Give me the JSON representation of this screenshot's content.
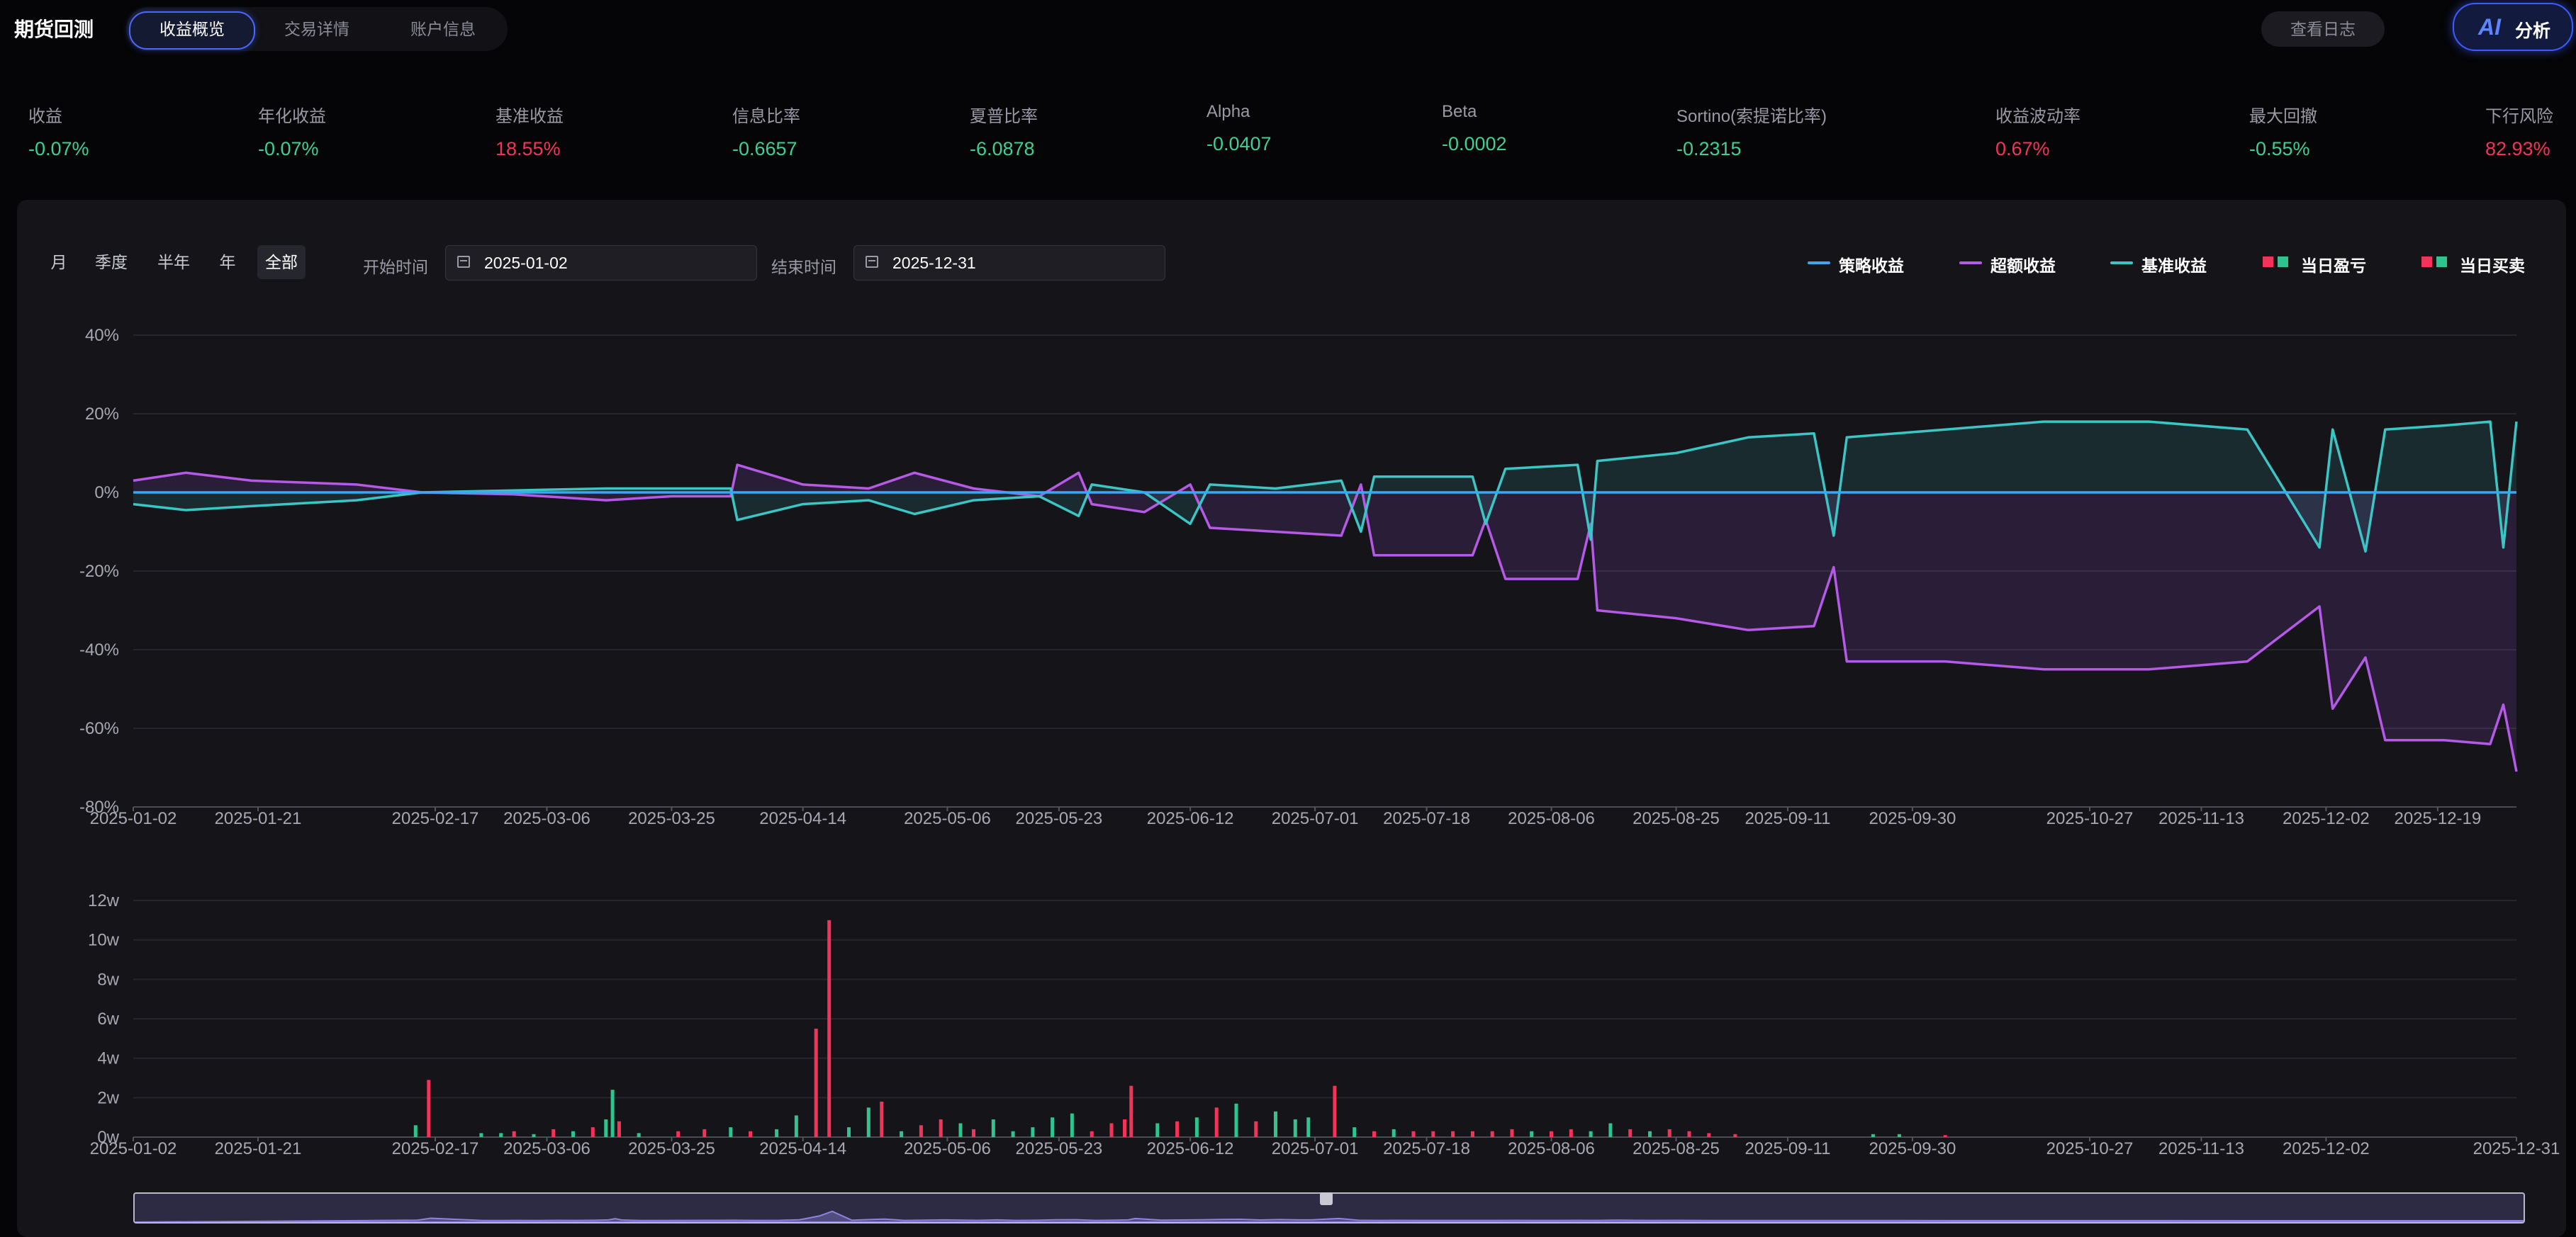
{
  "app_title": "期货回测",
  "tabs": [
    {
      "label": "收益概览",
      "active": true
    },
    {
      "label": "交易详情",
      "active": false
    },
    {
      "label": "账户信息",
      "active": false
    }
  ],
  "header_buttons": {
    "log": "查看日志",
    "ai_mark": "AI",
    "ai_label": "分析"
  },
  "metrics": [
    {
      "label": "收益",
      "value": "-0.07%",
      "color": "#3fcf95"
    },
    {
      "label": "年化收益",
      "value": "-0.07%",
      "color": "#3fcf95"
    },
    {
      "label": "基准收益",
      "value": "18.55%",
      "color": "#f4335a"
    },
    {
      "label": "信息比率",
      "value": "-0.6657",
      "color": "#3fcf95"
    },
    {
      "label": "夏普比率",
      "value": "-6.0878",
      "color": "#3fcf95"
    },
    {
      "label": "Alpha",
      "value": "-0.0407",
      "color": "#3fcf95"
    },
    {
      "label": "Beta",
      "value": "-0.0002",
      "color": "#3fcf95"
    },
    {
      "label": "Sortino(索提诺比率)",
      "value": "-0.2315",
      "color": "#3fcf95"
    },
    {
      "label": "收益波动率",
      "value": "0.67%",
      "color": "#f4335a"
    },
    {
      "label": "最大回撤",
      "value": "-0.55%",
      "color": "#3fcf95"
    },
    {
      "label": "下行风险",
      "value": "82.93%",
      "color": "#f4335a"
    }
  ],
  "filters": {
    "periods": [
      {
        "label": "月",
        "active": false
      },
      {
        "label": "季度",
        "active": false
      },
      {
        "label": "半年",
        "active": false
      },
      {
        "label": "年",
        "active": false
      },
      {
        "label": "全部",
        "active": true
      }
    ],
    "start_label": "开始时间",
    "start_value": "2025-01-02",
    "end_label": "结束时间",
    "end_value": "2025-12-31"
  },
  "legend": [
    {
      "label": "策略收益",
      "type": "line",
      "color": "#3aa7f0"
    },
    {
      "label": "超额收益",
      "type": "line",
      "color": "#b45ae6"
    },
    {
      "label": "基准收益",
      "type": "line",
      "color": "#3cc5c5"
    },
    {
      "label": "当日盈亏",
      "type": "square",
      "colors": [
        "#f4335a",
        "#2fc48e"
      ]
    },
    {
      "label": "当日买卖",
      "type": "square",
      "colors": [
        "#f4335a",
        "#2fc48e"
      ]
    }
  ],
  "chart_data": [
    {
      "type": "line",
      "y_ticks": [
        "40%",
        "20%",
        "0%",
        "-20%",
        "-40%",
        "-60%",
        "-80%"
      ],
      "ylim": [
        -80,
        40
      ],
      "x_tick_labels": [
        "2025-01-02",
        "2025-01-21",
        "2025-02-17",
        "2025-03-06",
        "2025-03-25",
        "2025-04-14",
        "2025-05-06",
        "2025-05-23",
        "2025-06-12",
        "2025-07-01",
        "2025-07-18",
        "2025-08-06",
        "2025-08-25",
        "2025-09-11",
        "2025-09-30",
        "2025-10-27",
        "2025-11-13",
        "2025-12-02",
        "2025-12-19"
      ],
      "x_domain": [
        "2025-01-02",
        "2025-12-31"
      ],
      "series": [
        {
          "name": "策略收益",
          "color": "#3aa7f0",
          "points": [
            [
              "2025-01-02",
              0
            ],
            [
              "2025-12-31",
              0
            ]
          ]
        },
        {
          "name": "基准收益",
          "color": "#3cc5c5",
          "points": [
            [
              "2025-01-02",
              -3
            ],
            [
              "2025-01-10",
              -4.5
            ],
            [
              "2025-01-20",
              -3.5
            ],
            [
              "2025-02-05",
              -2
            ],
            [
              "2025-02-15",
              0
            ],
            [
              "2025-03-01",
              0.5
            ],
            [
              "2025-03-15",
              1
            ],
            [
              "2025-03-25",
              1
            ],
            [
              "2025-04-03",
              1
            ],
            [
              "2025-04-04",
              -7
            ],
            [
              "2025-04-14",
              -3
            ],
            [
              "2025-04-24",
              -2
            ],
            [
              "2025-05-01",
              -5.5
            ],
            [
              "2025-05-10",
              -2
            ],
            [
              "2025-05-20",
              -1
            ],
            [
              "2025-05-26",
              -6
            ],
            [
              "2025-05-28",
              2
            ],
            [
              "2025-06-05",
              0
            ],
            [
              "2025-06-12",
              -8
            ],
            [
              "2025-06-15",
              2
            ],
            [
              "2025-06-25",
              1
            ],
            [
              "2025-07-05",
              3
            ],
            [
              "2025-07-08",
              -10
            ],
            [
              "2025-07-10",
              4
            ],
            [
              "2025-07-25",
              4
            ],
            [
              "2025-07-27",
              -8
            ],
            [
              "2025-07-30",
              6
            ],
            [
              "2025-08-10",
              7
            ],
            [
              "2025-08-12",
              -12
            ],
            [
              "2025-08-13",
              8
            ],
            [
              "2025-08-25",
              10
            ],
            [
              "2025-09-05",
              14
            ],
            [
              "2025-09-15",
              15
            ],
            [
              "2025-09-18",
              -11
            ],
            [
              "2025-09-20",
              14
            ],
            [
              "2025-10-05",
              16
            ],
            [
              "2025-10-20",
              18
            ],
            [
              "2025-11-05",
              18
            ],
            [
              "2025-11-20",
              16
            ],
            [
              "2025-12-01",
              -14
            ],
            [
              "2025-12-03",
              16
            ],
            [
              "2025-12-08",
              -15
            ],
            [
              "2025-12-11",
              16
            ],
            [
              "2025-12-20",
              17
            ],
            [
              "2025-12-27",
              18
            ],
            [
              "2025-12-29",
              -14
            ],
            [
              "2025-12-31",
              18
            ]
          ]
        },
        {
          "name": "超额收益",
          "color": "#b45ae6",
          "points": [
            [
              "2025-01-02",
              3
            ],
            [
              "2025-01-10",
              5
            ],
            [
              "2025-01-20",
              3
            ],
            [
              "2025-02-05",
              2
            ],
            [
              "2025-02-15",
              0
            ],
            [
              "2025-03-01",
              -0.5
            ],
            [
              "2025-03-15",
              -2
            ],
            [
              "2025-03-25",
              -1
            ],
            [
              "2025-04-03",
              -1
            ],
            [
              "2025-04-04",
              7
            ],
            [
              "2025-04-14",
              2
            ],
            [
              "2025-04-24",
              1
            ],
            [
              "2025-05-01",
              5
            ],
            [
              "2025-05-10",
              1
            ],
            [
              "2025-05-20",
              -1
            ],
            [
              "2025-05-26",
              5
            ],
            [
              "2025-05-28",
              -3
            ],
            [
              "2025-06-05",
              -5
            ],
            [
              "2025-06-12",
              2
            ],
            [
              "2025-06-15",
              -9
            ],
            [
              "2025-06-25",
              -10
            ],
            [
              "2025-07-05",
              -11
            ],
            [
              "2025-07-08",
              2
            ],
            [
              "2025-07-10",
              -16
            ],
            [
              "2025-07-25",
              -16
            ],
            [
              "2025-07-27",
              -7
            ],
            [
              "2025-07-30",
              -22
            ],
            [
              "2025-08-10",
              -22
            ],
            [
              "2025-08-12",
              -8
            ],
            [
              "2025-08-13",
              -30
            ],
            [
              "2025-08-25",
              -32
            ],
            [
              "2025-09-05",
              -35
            ],
            [
              "2025-09-15",
              -34
            ],
            [
              "2025-09-18",
              -19
            ],
            [
              "2025-09-20",
              -43
            ],
            [
              "2025-10-05",
              -43
            ],
            [
              "2025-10-20",
              -45
            ],
            [
              "2025-11-05",
              -45
            ],
            [
              "2025-11-20",
              -43
            ],
            [
              "2025-12-01",
              -29
            ],
            [
              "2025-12-03",
              -55
            ],
            [
              "2025-12-08",
              -42
            ],
            [
              "2025-12-11",
              -63
            ],
            [
              "2025-12-20",
              -63
            ],
            [
              "2025-12-27",
              -64
            ],
            [
              "2025-12-29",
              -54
            ],
            [
              "2025-12-31",
              -71
            ]
          ]
        }
      ]
    },
    {
      "type": "bar",
      "y_ticks": [
        "12w",
        "10w",
        "8w",
        "6w",
        "4w",
        "2w",
        "0w"
      ],
      "ylim": [
        0,
        12
      ],
      "x_tick_labels": [
        "2025-01-02",
        "2025-01-21",
        "2025-02-17",
        "2025-03-06",
        "2025-03-25",
        "2025-04-14",
        "2025-05-06",
        "2025-05-23",
        "2025-06-12",
        "2025-07-01",
        "2025-07-18",
        "2025-08-06",
        "2025-08-25",
        "2025-09-11",
        "2025-09-30",
        "2025-10-27",
        "2025-11-13",
        "2025-12-02",
        "2025-12-31"
      ],
      "x_domain": [
        "2025-01-02",
        "2025-12-31"
      ],
      "bars": [
        [
          "2025-02-14",
          0.6,
          "g"
        ],
        [
          "2025-02-16",
          2.9,
          "r"
        ],
        [
          "2025-02-24",
          0.2,
          "g"
        ],
        [
          "2025-02-27",
          0.2,
          "g"
        ],
        [
          "2025-03-01",
          0.3,
          "r"
        ],
        [
          "2025-03-04",
          0.15,
          "g"
        ],
        [
          "2025-03-07",
          0.4,
          "r"
        ],
        [
          "2025-03-10",
          0.3,
          "g"
        ],
        [
          "2025-03-13",
          0.5,
          "r"
        ],
        [
          "2025-03-15",
          0.9,
          "g"
        ],
        [
          "2025-03-16",
          2.4,
          "g"
        ],
        [
          "2025-03-17",
          0.8,
          "r"
        ],
        [
          "2025-03-20",
          0.2,
          "g"
        ],
        [
          "2025-03-26",
          0.3,
          "r"
        ],
        [
          "2025-03-30",
          0.4,
          "r"
        ],
        [
          "2025-04-03",
          0.5,
          "g"
        ],
        [
          "2025-04-06",
          0.3,
          "r"
        ],
        [
          "2025-04-10",
          0.4,
          "g"
        ],
        [
          "2025-04-13",
          1.1,
          "g"
        ],
        [
          "2025-04-16",
          5.5,
          "r"
        ],
        [
          "2025-04-18",
          11.0,
          "r"
        ],
        [
          "2025-04-21",
          0.5,
          "g"
        ],
        [
          "2025-04-24",
          1.5,
          "g"
        ],
        [
          "2025-04-26",
          1.8,
          "r"
        ],
        [
          "2025-04-29",
          0.3,
          "g"
        ],
        [
          "2025-05-02",
          0.6,
          "r"
        ],
        [
          "2025-05-05",
          0.9,
          "r"
        ],
        [
          "2025-05-08",
          0.7,
          "g"
        ],
        [
          "2025-05-10",
          0.4,
          "r"
        ],
        [
          "2025-05-13",
          0.9,
          "g"
        ],
        [
          "2025-05-16",
          0.3,
          "g"
        ],
        [
          "2025-05-19",
          0.5,
          "g"
        ],
        [
          "2025-05-22",
          1.0,
          "g"
        ],
        [
          "2025-05-25",
          1.2,
          "g"
        ],
        [
          "2025-05-28",
          0.3,
          "r"
        ],
        [
          "2025-05-31",
          0.7,
          "r"
        ],
        [
          "2025-06-02",
          0.9,
          "r"
        ],
        [
          "2025-06-03",
          2.6,
          "r"
        ],
        [
          "2025-06-07",
          0.7,
          "g"
        ],
        [
          "2025-06-10",
          0.8,
          "r"
        ],
        [
          "2025-06-13",
          1.0,
          "g"
        ],
        [
          "2025-06-16",
          1.5,
          "r"
        ],
        [
          "2025-06-19",
          1.7,
          "g"
        ],
        [
          "2025-06-22",
          0.8,
          "r"
        ],
        [
          "2025-06-25",
          1.3,
          "g"
        ],
        [
          "2025-06-28",
          0.9,
          "g"
        ],
        [
          "2025-06-30",
          1.0,
          "g"
        ],
        [
          "2025-07-04",
          2.6,
          "r"
        ],
        [
          "2025-07-07",
          0.5,
          "g"
        ],
        [
          "2025-07-10",
          0.3,
          "r"
        ],
        [
          "2025-07-13",
          0.4,
          "g"
        ],
        [
          "2025-07-16",
          0.3,
          "r"
        ],
        [
          "2025-07-19",
          0.3,
          "r"
        ],
        [
          "2025-07-22",
          0.3,
          "r"
        ],
        [
          "2025-07-25",
          0.3,
          "r"
        ],
        [
          "2025-07-28",
          0.3,
          "r"
        ],
        [
          "2025-07-31",
          0.4,
          "r"
        ],
        [
          "2025-08-03",
          0.3,
          "g"
        ],
        [
          "2025-08-06",
          0.3,
          "r"
        ],
        [
          "2025-08-09",
          0.4,
          "r"
        ],
        [
          "2025-08-12",
          0.3,
          "g"
        ],
        [
          "2025-08-15",
          0.7,
          "g"
        ],
        [
          "2025-08-18",
          0.4,
          "r"
        ],
        [
          "2025-08-21",
          0.3,
          "g"
        ],
        [
          "2025-08-24",
          0.4,
          "r"
        ],
        [
          "2025-08-27",
          0.3,
          "r"
        ],
        [
          "2025-08-30",
          0.2,
          "r"
        ],
        [
          "2025-09-03",
          0.15,
          "r"
        ],
        [
          "2025-09-24",
          0.15,
          "g"
        ],
        [
          "2025-09-28",
          0.15,
          "g"
        ],
        [
          "2025-10-05",
          0.1,
          "r"
        ]
      ]
    }
  ]
}
